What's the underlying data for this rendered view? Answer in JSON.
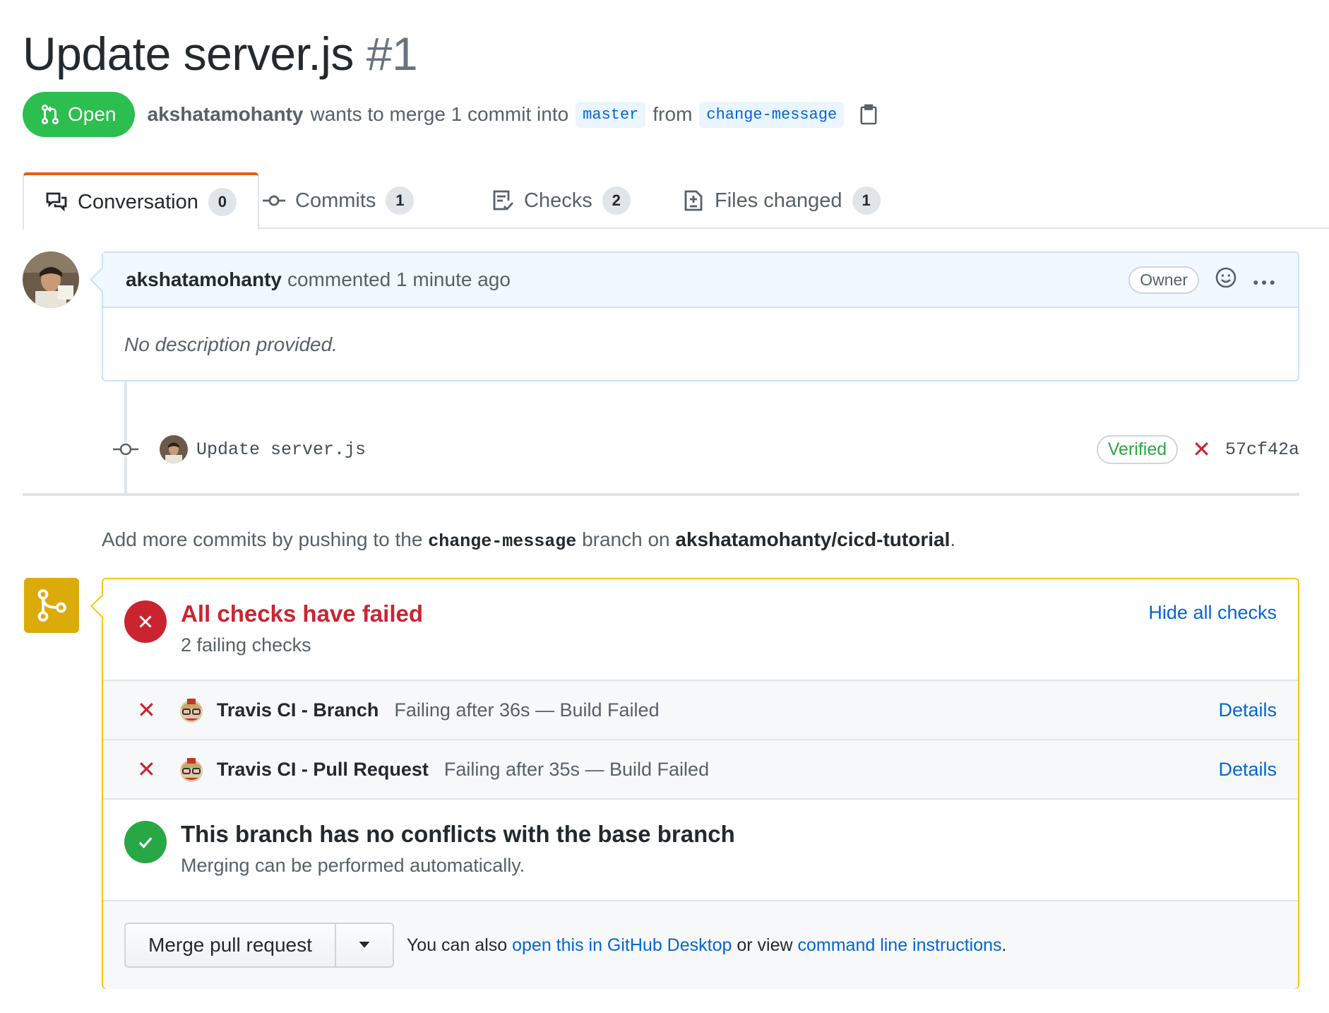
{
  "pr": {
    "title": "Update server.js",
    "number": "#1",
    "state": "Open",
    "author": "akshatamohanty",
    "merge_text": "wants to merge 1 commit into",
    "base_branch": "master",
    "from_text": "from",
    "head_branch": "change-message"
  },
  "tabs": [
    {
      "label": "Conversation",
      "count": "0",
      "icon": "comment-discussion-icon"
    },
    {
      "label": "Commits",
      "count": "1",
      "icon": "git-commit-icon"
    },
    {
      "label": "Checks",
      "count": "2",
      "icon": "checklist-icon"
    },
    {
      "label": "Files changed",
      "count": "1",
      "icon": "diff-icon"
    }
  ],
  "comment": {
    "author": "akshatamohanty",
    "action": "commented 1 minute ago",
    "role_badge": "Owner",
    "body": "No description provided."
  },
  "commit": {
    "message": "Update server.js",
    "verified": "Verified",
    "sha": "57cf42a"
  },
  "push_note": {
    "prefix": "Add more commits by pushing to the",
    "branch": "change-message",
    "middle": "branch on",
    "repo": "akshatamohanty/cicd-tutorial",
    "suffix": "."
  },
  "checks": {
    "title": "All checks have failed",
    "subtitle": "2 failing checks",
    "hide_link": "Hide all checks",
    "items": [
      {
        "name": "Travis CI - Branch",
        "description": "Failing after 36s — Build Failed",
        "details": "Details"
      },
      {
        "name": "Travis CI - Pull Request",
        "description": "Failing after 35s — Build Failed",
        "details": "Details"
      }
    ]
  },
  "conflicts": {
    "title": "This branch has no conflicts with the base branch",
    "subtitle": "Merging can be performed automatically."
  },
  "merge_actions": {
    "button": "Merge pull request",
    "text1": "You can also",
    "link1": "open this in GitHub Desktop",
    "text2": "or view",
    "link2": "command line instructions",
    "text3": "."
  },
  "colors": {
    "open_green": "#2cbe4e",
    "fail_red": "#cb2431",
    "pass_green": "#28a745",
    "link_blue": "#0366d6",
    "warning_yellow": "#dbab09"
  }
}
